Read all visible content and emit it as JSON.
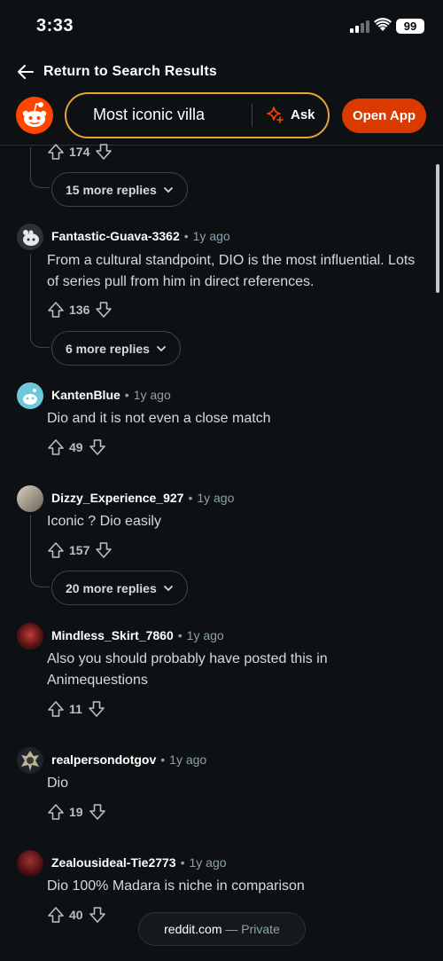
{
  "status": {
    "time": "3:33",
    "battery": "99"
  },
  "nav": {
    "back_label": "Return to Search Results"
  },
  "search": {
    "query": "Most iconic villa",
    "ask_label": "Ask",
    "open_app_label": "Open App"
  },
  "colors": {
    "accent": "#ff4500",
    "open_app": "#d93a00",
    "search_border": "#e8a33b",
    "background": "#0e1113"
  },
  "top_partial": {
    "votes": "174",
    "more_replies": "15 more replies"
  },
  "comments": [
    {
      "author": "Fantastic-Guava-3362",
      "age": "1y ago",
      "body": "From a cultural standpoint, DIO is the most influential. Lots of series pull from him in direct references.",
      "votes": "136",
      "more_replies": "6 more replies",
      "avatar": "snoo-avatar-white"
    },
    {
      "author": "KantenBlue",
      "age": "1y ago",
      "body": "Dio and it is not even a close match",
      "votes": "49",
      "avatar": "snoo-avatar-blue"
    },
    {
      "author": "Dizzy_Experience_927",
      "age": "1y ago",
      "body": "Iconic ? Dio easily",
      "votes": "157",
      "more_replies": "20 more replies",
      "avatar": "photo-avatar"
    },
    {
      "author": "Mindless_Skirt_7860",
      "age": "1y ago",
      "body": "Also you should probably have posted this in Animequestions",
      "votes": "11",
      "avatar": "photo-avatar-red"
    },
    {
      "author": "realpersondotgov",
      "age": "1y ago",
      "body": "Dio",
      "votes": "19",
      "avatar": "character-avatar"
    },
    {
      "author": "Zealousideal-Tie2773",
      "age": "1y ago",
      "body": "Dio 100% Madara is niche in comparison",
      "votes": "40",
      "avatar": "photo-avatar-red"
    }
  ],
  "toast": {
    "domain": "reddit.com",
    "separator": " — ",
    "mode": "Private"
  }
}
